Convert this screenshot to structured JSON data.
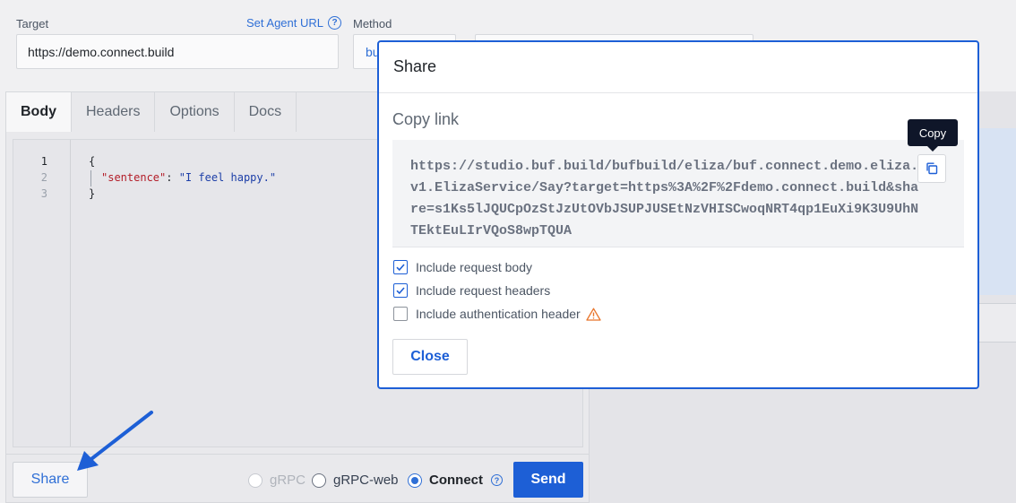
{
  "target": {
    "label": "Target",
    "set_agent_url": "Set Agent URL",
    "help_glyph": "?",
    "value": "https://demo.connect.build"
  },
  "method": {
    "label": "Method",
    "value_partial": "bu"
  },
  "tabs": [
    {
      "label": "Body",
      "active": true
    },
    {
      "label": "Headers",
      "active": false
    },
    {
      "label": "Options",
      "active": false
    },
    {
      "label": "Docs",
      "active": false
    }
  ],
  "editor": {
    "line_numbers": [
      "1",
      "2",
      "3"
    ],
    "line1": "{",
    "key": "\"sentence\"",
    "colon": ": ",
    "value": "\"I feel happy.\"",
    "line3": "}"
  },
  "bottom": {
    "share_label": "Share",
    "protocols": [
      {
        "label": "gRPC",
        "state": "disabled"
      },
      {
        "label": "gRPC-web",
        "state": "unselected"
      },
      {
        "label": "Connect",
        "state": "selected"
      }
    ],
    "help_glyph": "?",
    "send_label": "Send"
  },
  "modal": {
    "title": "Share",
    "copy_heading": "Copy link",
    "url": "https://studio.buf.build/bufbuild/eliza/buf.connect.demo.eliza.v1.ElizaService/Say?target=https%3A%2F%2Fdemo.connect.build&share=s1Ks5lJQUCpOzStJzUtOVbJSUPJUSEtNzVHISCwoqNRT4qp1EuXi9K3U9UhNTEktEuLIrVQoS8wpTQUA",
    "copy_tooltip": "Copy",
    "options": [
      {
        "label": "Include request body",
        "checked": true
      },
      {
        "label": "Include request headers",
        "checked": true
      },
      {
        "label": "Include authentication header",
        "checked": false,
        "warning": true
      }
    ],
    "close_label": "Close"
  },
  "colors": {
    "accent": "#1d5fd6",
    "link": "#2f6fd6",
    "warning": "#e8742a",
    "tooltip_bg": "#0f1629"
  },
  "icons": [
    "help-icon",
    "copy-icon",
    "checkbox-check-icon",
    "warning-icon",
    "annotation-arrow-icon"
  ]
}
